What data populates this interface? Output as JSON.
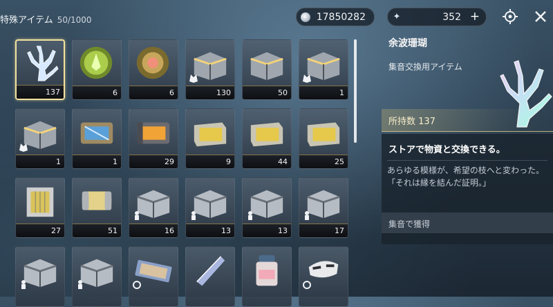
{
  "header": {
    "title": "特殊アイテム",
    "capacity": "50/1000",
    "coins": "17850282",
    "stars": "352",
    "stars_plus": "+"
  },
  "grid": {
    "items": [
      {
        "qty": "137",
        "kind": "coral",
        "selected": true
      },
      {
        "qty": "6",
        "kind": "orb-green"
      },
      {
        "qty": "6",
        "kind": "orb-red"
      },
      {
        "qty": "130",
        "kind": "crate-gold",
        "badge": "wolf"
      },
      {
        "qty": "50",
        "kind": "crate-gold"
      },
      {
        "qty": "1",
        "kind": "crate-gold",
        "badge": "wolf"
      },
      {
        "qty": "1",
        "kind": "crate-gold",
        "badge": "wolf"
      },
      {
        "qty": "1",
        "kind": "crate-blue"
      },
      {
        "qty": "29",
        "kind": "crate-orange"
      },
      {
        "qty": "9",
        "kind": "crate-yellow"
      },
      {
        "qty": "44",
        "kind": "crate-yellow"
      },
      {
        "qty": "25",
        "kind": "crate-yellow"
      },
      {
        "qty": "27",
        "kind": "cage"
      },
      {
        "qty": "51",
        "kind": "canister"
      },
      {
        "qty": "16",
        "kind": "crate-silver",
        "badge": "figure"
      },
      {
        "qty": "13",
        "kind": "crate-silver",
        "badge": "figure"
      },
      {
        "qty": "13",
        "kind": "crate-silver",
        "badge": "figure"
      },
      {
        "qty": "17",
        "kind": "crate-silver",
        "badge": "figure"
      },
      {
        "qty": "",
        "kind": "crate-silver",
        "badge": "figure"
      },
      {
        "qty": "",
        "kind": "crate-silver",
        "badge": "figure"
      },
      {
        "qty": "",
        "kind": "ticket",
        "badge": "ring"
      },
      {
        "qty": "",
        "kind": "crystal"
      },
      {
        "qty": "",
        "kind": "jar"
      },
      {
        "qty": "",
        "kind": "mask",
        "badge": "ring"
      }
    ]
  },
  "detail": {
    "name": "余波珊瑚",
    "type": "集音交換用アイテム",
    "owned": "所持数 137",
    "description": "ストアで物資と交換できる。",
    "flavor_line1": "あらゆる模様が、希望の枝へと変わった。",
    "flavor_line2": "「それは縁を結んだ証明。」",
    "source": "集音で獲得"
  },
  "colors": {
    "gold_accent": "#e6c878",
    "selected_border": "#f3e3a0",
    "coral_main": "#cfe6ff"
  }
}
